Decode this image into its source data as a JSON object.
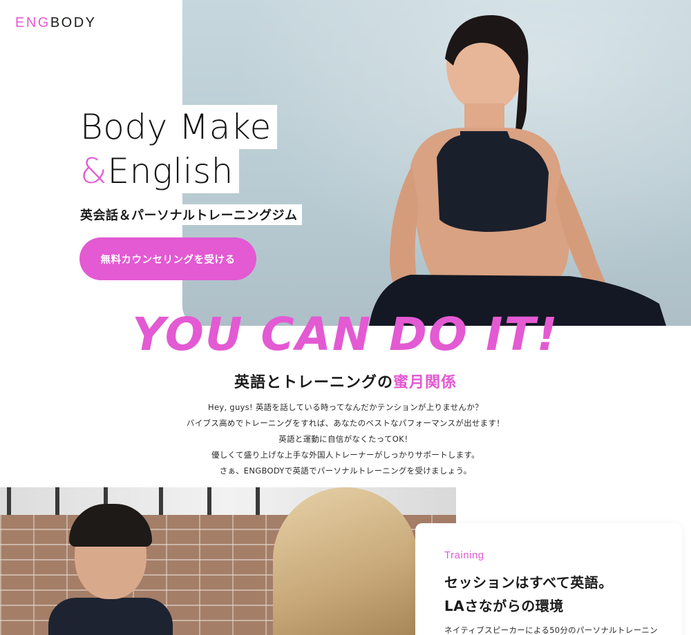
{
  "logo": {
    "eng": "ENG",
    "body": "BODY"
  },
  "hero": {
    "title_line1": "Body Make",
    "title_amp": "&",
    "title_line2": "English",
    "subtitle": "英会話＆パーソナルトレーニングジム",
    "cta_label": "無料カウンセリングを受ける"
  },
  "slogan": "YOU CAN DO IT!",
  "section": {
    "heading_prefix": "英語とトレーニングの",
    "heading_highlight": "蜜月関係",
    "lines": [
      "Hey, guys! 英語を話している時ってなんだかテンションが上りませんか？",
      "バイブス高めでトレーニングをすれば、あなたのベストなパフォーマンスが出せます！",
      "英語と運動に自信がなくたってOK！",
      "優しくて盛り上げな上手な外国人トレーナーがしっかりサポートします。",
      "さぁ、ENGBODYで英語でパーソナルトレーニングを受けましょう。"
    ]
  },
  "training": {
    "label": "Training",
    "title_line1": "セッションはすべて英語。",
    "title_line2": "LAさながらの環境",
    "desc": "ネイティブスピーカーによる50分のパーソナルトレーニン"
  },
  "colors": {
    "accent": "#e35ad3",
    "text": "#1b1b1b",
    "hero_bg": "#c6d7dd"
  }
}
